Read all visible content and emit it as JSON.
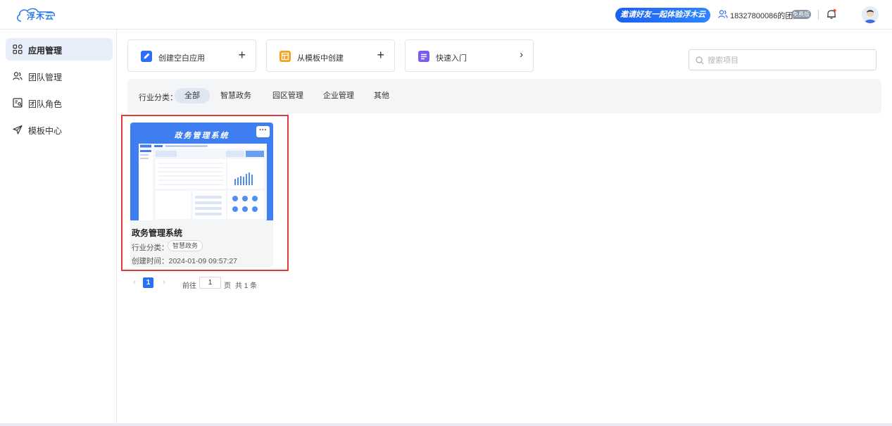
{
  "header": {
    "logo_text": "浮木云",
    "invite_label": "邀请好友一起体验浮木云",
    "team_name": "18327800086的团队",
    "plan_badge": "免费版"
  },
  "sidebar": {
    "items": [
      {
        "label": "应用管理",
        "icon": "grid-icon",
        "active": true
      },
      {
        "label": "团队管理",
        "icon": "team-icon",
        "active": false
      },
      {
        "label": "团队角色",
        "icon": "role-icon",
        "active": false
      },
      {
        "label": "模板中心",
        "icon": "send-icon",
        "active": false
      }
    ]
  },
  "actions": {
    "create_blank": {
      "label": "创建空白应用",
      "icon": "edit-icon",
      "color": "#2a6ff6"
    },
    "from_template": {
      "label": "从模板中创建",
      "icon": "template-icon",
      "color": "#f7a21b"
    },
    "quick_start": {
      "label": "快速入门",
      "icon": "doc-icon",
      "color": "#7b5cf0"
    }
  },
  "search": {
    "placeholder": "搜索项目"
  },
  "filter": {
    "label": "行业分类：",
    "options": [
      "全部",
      "智慧政务",
      "园区管理",
      "企业管理",
      "其他"
    ],
    "active": "全部"
  },
  "apps": [
    {
      "thumbnail_title": "政务管理系统",
      "name": "政务管理系统",
      "category_label": "行业分类：",
      "category": "智慧政务",
      "created_label": "创建时间：",
      "created_at": "2024-01-09 09:57:27",
      "created_text": "创建时间：2024-01-09 09:57:27",
      "more_label": "···"
    }
  ],
  "pagination": {
    "current": "1",
    "goto_label": "前往",
    "page_value": "1",
    "page_label": "页",
    "total_label": "共 1 条"
  },
  "colors": {
    "primary": "#2a6ff6",
    "highlight_border": "#e53935",
    "thumb_bg": "#3f7ef0"
  }
}
